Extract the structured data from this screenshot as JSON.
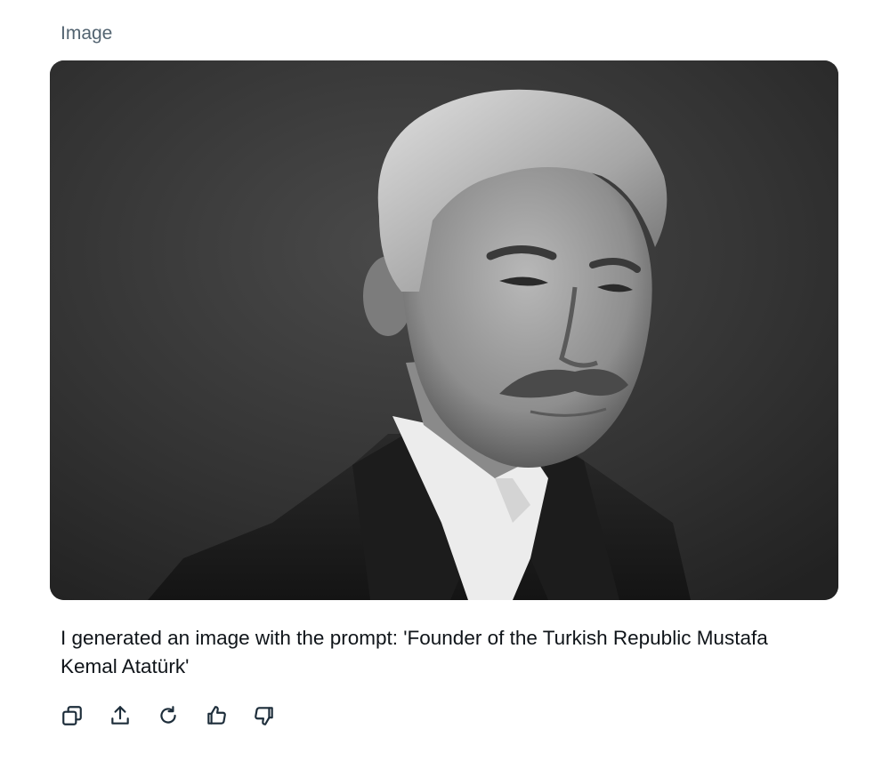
{
  "section": {
    "label": "Image"
  },
  "image": {
    "alt": ""
  },
  "caption": {
    "text": "I generated an image with the prompt: 'Founder of the Turkish Republic Mustafa Kemal Atatürk'"
  },
  "actions": [
    {
      "icon": "copy-icon"
    },
    {
      "icon": "share-icon"
    },
    {
      "icon": "regenerate-icon"
    },
    {
      "icon": "thumbs-up-icon"
    },
    {
      "icon": "thumbs-down-icon"
    }
  ],
  "colors": {
    "label": "#536471",
    "text": "#0f1419",
    "icon": "#1d2d3a",
    "background": "#ffffff"
  }
}
